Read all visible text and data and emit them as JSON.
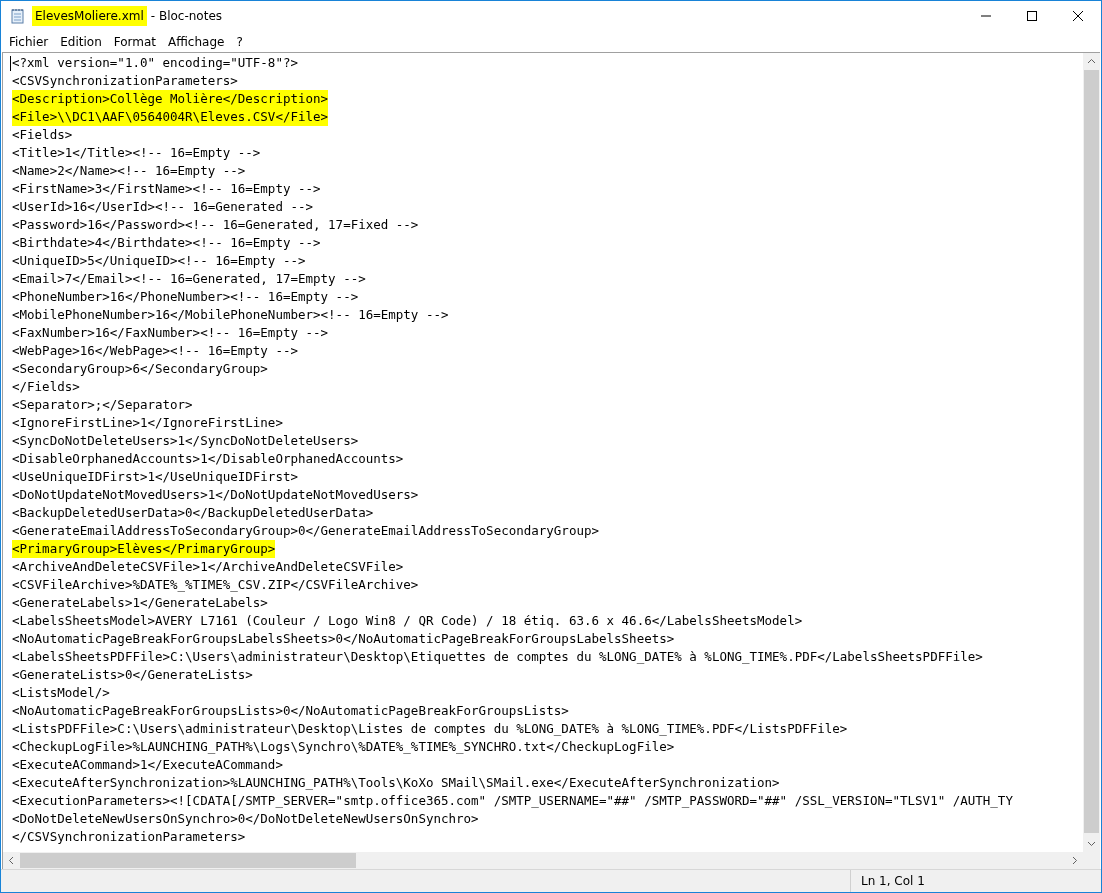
{
  "window": {
    "file": "ElevesMoliere.xml",
    "file_highlighted": true,
    "app": "- Bloc-notes"
  },
  "menu": [
    "Fichier",
    "Edition",
    "Format",
    "Affichage",
    "?"
  ],
  "lines": [
    {
      "text": "<?xml version=\"1.0\" encoding=\"UTF-8\"?>",
      "highlighted": false
    },
    {
      "text": "<CSVSynchronizationParameters>",
      "highlighted": false
    },
    {
      "text": "<Description>Collège Molière</Description>",
      "highlighted": true
    },
    {
      "text": "<File>\\\\DC1\\AAF\\0564004R\\Eleves.CSV</File>",
      "highlighted": true
    },
    {
      "text": "<Fields>",
      "highlighted": false
    },
    {
      "text": "<Title>1</Title><!-- 16=Empty -->",
      "highlighted": false
    },
    {
      "text": "<Name>2</Name><!-- 16=Empty -->",
      "highlighted": false
    },
    {
      "text": "<FirstName>3</FirstName><!-- 16=Empty -->",
      "highlighted": false
    },
    {
      "text": "<UserId>16</UserId><!-- 16=Generated -->",
      "highlighted": false
    },
    {
      "text": "<Password>16</Password><!-- 16=Generated, 17=Fixed -->",
      "highlighted": false
    },
    {
      "text": "<Birthdate>4</Birthdate><!-- 16=Empty -->",
      "highlighted": false
    },
    {
      "text": "<UniqueID>5</UniqueID><!-- 16=Empty -->",
      "highlighted": false
    },
    {
      "text": "<Email>7</Email><!-- 16=Generated, 17=Empty -->",
      "highlighted": false
    },
    {
      "text": "<PhoneNumber>16</PhoneNumber><!-- 16=Empty -->",
      "highlighted": false
    },
    {
      "text": "<MobilePhoneNumber>16</MobilePhoneNumber><!-- 16=Empty -->",
      "highlighted": false
    },
    {
      "text": "<FaxNumber>16</FaxNumber><!-- 16=Empty -->",
      "highlighted": false
    },
    {
      "text": "<WebPage>16</WebPage><!-- 16=Empty -->",
      "highlighted": false
    },
    {
      "text": "<SecondaryGroup>6</SecondaryGroup>",
      "highlighted": false
    },
    {
      "text": "</Fields>",
      "highlighted": false
    },
    {
      "text": "<Separator>;</Separator>",
      "highlighted": false
    },
    {
      "text": "<IgnoreFirstLine>1</IgnoreFirstLine>",
      "highlighted": false
    },
    {
      "text": "<SyncDoNotDeleteUsers>1</SyncDoNotDeleteUsers>",
      "highlighted": false
    },
    {
      "text": "<DisableOrphanedAccounts>1</DisableOrphanedAccounts>",
      "highlighted": false
    },
    {
      "text": "<UseUniqueIDFirst>1</UseUniqueIDFirst>",
      "highlighted": false
    },
    {
      "text": "<DoNotUpdateNotMovedUsers>1</DoNotUpdateNotMovedUsers>",
      "highlighted": false
    },
    {
      "text": "<BackupDeletedUserData>0</BackupDeletedUserData>",
      "highlighted": false
    },
    {
      "text": "<GenerateEmailAddressToSecondaryGroup>0</GenerateEmailAddressToSecondaryGroup>",
      "highlighted": false
    },
    {
      "text": "<PrimaryGroup>Elèves</PrimaryGroup>",
      "highlighted": true
    },
    {
      "text": "<ArchiveAndDeleteCSVFile>1</ArchiveAndDeleteCSVFile>",
      "highlighted": false
    },
    {
      "text": "<CSVFileArchive>%DATE%_%TIME%_CSV.ZIP</CSVFileArchive>",
      "highlighted": false
    },
    {
      "text": "<GenerateLabels>1</GenerateLabels>",
      "highlighted": false
    },
    {
      "text": "<LabelsSheetsModel>AVERY L7161 (Couleur / Logo Win8 / QR Code) / 18 étiq. 63.6 x 46.6</LabelsSheetsModel>",
      "highlighted": false
    },
    {
      "text": "<NoAutomaticPageBreakForGroupsLabelsSheets>0</NoAutomaticPageBreakForGroupsLabelsSheets>",
      "highlighted": false
    },
    {
      "text": "<LabelsSheetsPDFFile>C:\\Users\\administrateur\\Desktop\\Etiquettes de comptes du %LONG_DATE% à %LONG_TIME%.PDF</LabelsSheetsPDFFile>",
      "highlighted": false
    },
    {
      "text": "<GenerateLists>0</GenerateLists>",
      "highlighted": false
    },
    {
      "text": "<ListsModel/>",
      "highlighted": false
    },
    {
      "text": "<NoAutomaticPageBreakForGroupsLists>0</NoAutomaticPageBreakForGroupsLists>",
      "highlighted": false
    },
    {
      "text": "<ListsPDFFile>C:\\Users\\administrateur\\Desktop\\Listes de comptes du %LONG_DATE% à %LONG_TIME%.PDF</ListsPDFFile>",
      "highlighted": false
    },
    {
      "text": "<CheckupLogFile>%LAUNCHING_PATH%\\Logs\\Synchro\\%DATE%_%TIME%_SYNCHRO.txt</CheckupLogFile>",
      "highlighted": false
    },
    {
      "text": "<ExecuteACommand>1</ExecuteACommand>",
      "highlighted": false
    },
    {
      "text": "<ExecuteAfterSynchronization>%LAUNCHING_PATH%\\Tools\\KoXo SMail\\SMail.exe</ExecuteAfterSynchronization>",
      "highlighted": false
    },
    {
      "text": "<ExecutionParameters><![CDATA[/SMTP_SERVER=\"smtp.office365.com\" /SMTP_USERNAME=\"##\" /SMTP_PASSWORD=\"##\" /SSL_VERSION=\"TLSV1\" /AUTH_TY",
      "highlighted": false
    },
    {
      "text": "<DoNotDeleteNewUsersOnSynchro>0</DoNotDeleteNewUsersOnSynchro>",
      "highlighted": false
    },
    {
      "text": "</CSVSynchronizationParameters>",
      "highlighted": false
    }
  ],
  "status_bar": {
    "position": "Ln 1, Col 1"
  }
}
